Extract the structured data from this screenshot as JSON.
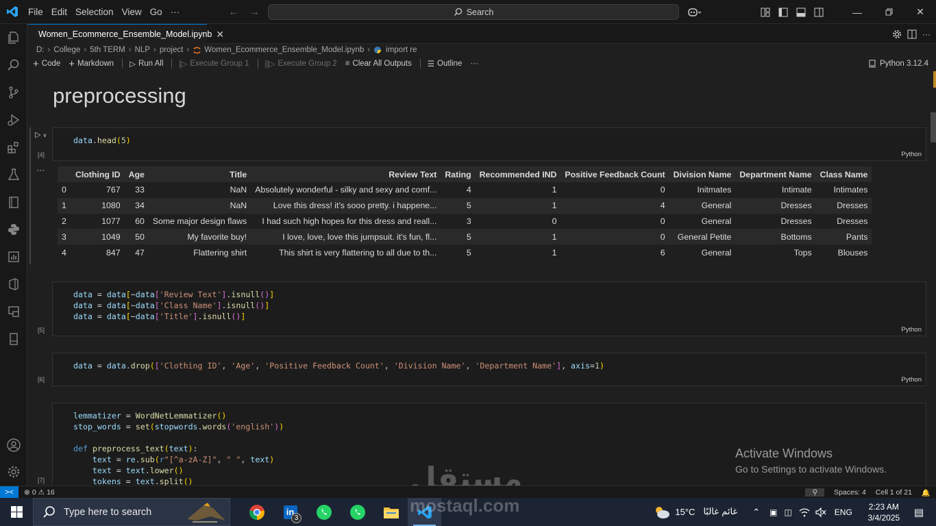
{
  "titlebar": {
    "menu": [
      "File",
      "Edit",
      "Selection",
      "View",
      "Go",
      "···"
    ],
    "search_placeholder": "Search"
  },
  "tab": {
    "label": "Women_Ecommerce_Ensemble_Model.ipynb"
  },
  "breadcrumb": [
    "D:",
    "College",
    "5th TERM",
    "NLP",
    "project",
    "Women_Ecommerce_Ensemble_Model.ipynb",
    "import re"
  ],
  "toolbar": {
    "code": "Code",
    "markdown": "Markdown",
    "run_all": "Run All",
    "execute_group_1": "Execute Group 1",
    "execute_group_2": "Execute Group 2",
    "clear_all_outputs": "Clear All Outputs",
    "outline": "Outline",
    "more": "···",
    "kernel": "Python 3.12.4"
  },
  "notebook": {
    "heading": "preprocessing",
    "cells": [
      {
        "count": "[4]",
        "lang": "Python"
      },
      {
        "count": "[5]",
        "lang": "Python"
      },
      {
        "count": "[6]",
        "lang": "Python"
      },
      {
        "count": "[7]",
        "lang": ""
      }
    ],
    "output_more": "···",
    "table": {
      "columns": [
        "",
        "Clothing ID",
        "Age",
        "Title",
        "Review Text",
        "Rating",
        "Recommended IND",
        "Positive Feedback Count",
        "Division Name",
        "Department Name",
        "Class Name"
      ],
      "rows": [
        [
          "0",
          "767",
          "33",
          "NaN",
          "Absolutely wonderful - silky and sexy and comf...",
          "4",
          "1",
          "0",
          "Initmates",
          "Intimate",
          "Intimates"
        ],
        [
          "1",
          "1080",
          "34",
          "NaN",
          "Love this dress! it's sooo pretty. i happene...",
          "5",
          "1",
          "4",
          "General",
          "Dresses",
          "Dresses"
        ],
        [
          "2",
          "1077",
          "60",
          "Some major design flaws",
          "I had such high hopes for this dress and reall...",
          "3",
          "0",
          "0",
          "General",
          "Dresses",
          "Dresses"
        ],
        [
          "3",
          "1049",
          "50",
          "My favorite buy!",
          "I love, love, love this jumpsuit. it's fun, fl...",
          "5",
          "1",
          "0",
          "General Petite",
          "Bottoms",
          "Pants"
        ],
        [
          "4",
          "847",
          "47",
          "Flattering shirt",
          "This shirt is very flattering to all due to th...",
          "5",
          "1",
          "6",
          "General",
          "Tops",
          "Blouses"
        ]
      ]
    }
  },
  "watermark": {
    "activate_title": "Activate Windows",
    "activate_sub": "Go to Settings to activate Windows.",
    "site_ar": "مستقل",
    "site_en": "mostaql.com"
  },
  "statusbar": {
    "errors": "0",
    "warnings": "16",
    "spaces": "Spaces: 4",
    "cell": "Cell 1 of 21"
  },
  "taskbar": {
    "search_placeholder": "Type here to search",
    "linkedin_badge": "3",
    "weather_temp": "15°C",
    "weather_desc": "غائم غالبًا",
    "lang": "ENG",
    "time": "2:23 AM",
    "date": "3/4/2025"
  },
  "colors": {
    "accent": "#0078d4",
    "background": "#1f1f1f",
    "taskbar": "#1c2433"
  }
}
